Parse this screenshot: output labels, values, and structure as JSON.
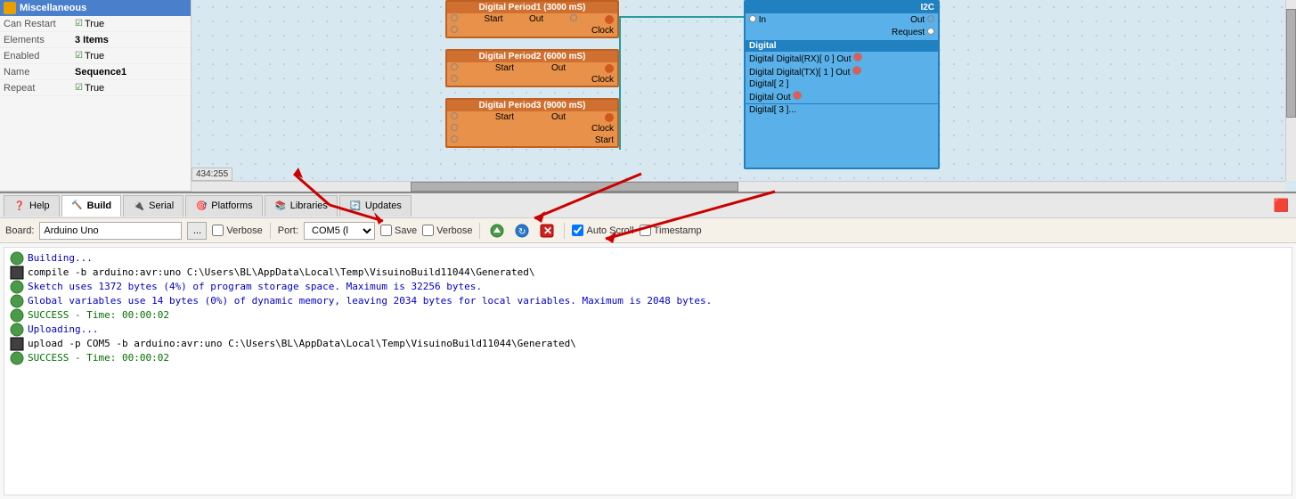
{
  "leftPanel": {
    "header": "Miscellaneous",
    "properties": [
      {
        "label": "Can Restart",
        "value": "True",
        "checkbox": true
      },
      {
        "label": "Elements",
        "value": "3 Items",
        "checkbox": false
      },
      {
        "label": "Enabled",
        "value": "True",
        "checkbox": true
      },
      {
        "label": "Name",
        "value": "Sequence1",
        "bold": true
      },
      {
        "label": "Repeat",
        "value": "True",
        "checkbox": true
      }
    ]
  },
  "canvas": {
    "coords": "434:255"
  },
  "tabs": [
    {
      "id": "help",
      "label": "Help",
      "icon": "❓",
      "active": false
    },
    {
      "id": "build",
      "label": "Build",
      "icon": "🔨",
      "active": true
    },
    {
      "id": "serial",
      "label": "Serial",
      "icon": "🔌",
      "active": false
    },
    {
      "id": "platforms",
      "label": "Platforms",
      "icon": "🎯",
      "active": false
    },
    {
      "id": "libraries",
      "label": "Libraries",
      "icon": "📚",
      "active": false
    },
    {
      "id": "updates",
      "label": "Updates",
      "icon": "🔄",
      "active": false
    }
  ],
  "toolbar": {
    "boardLabel": "Board:",
    "boardValue": "Arduino Uno",
    "browseBtn": "...",
    "verboseLabel1": "Verbose",
    "portLabel": "Port:",
    "portValue": "COM5 (l",
    "saveLabel": "Save",
    "verboseLabel2": "Verbose",
    "autoScrollLabel": "Auto Scroll",
    "timestampLabel": "Timestamp"
  },
  "output": {
    "lines": [
      {
        "type": "info",
        "text": "Building..."
      },
      {
        "type": "black",
        "text": "compile -b arduino:avr:uno C:\\Users\\BL\\AppData\\Local\\Temp\\VisuinoBuild11044\\Generated\\"
      },
      {
        "type": "info",
        "text": "Sketch uses 1372 bytes (4%) of program storage space. Maximum is 32256 bytes."
      },
      {
        "type": "info",
        "text": "Global variables use 14 bytes (0%) of dynamic memory, leaving 2034 bytes for local variables. Maximum is 2048 bytes."
      },
      {
        "type": "success",
        "text": "SUCCESS - Time: 00:00:02"
      },
      {
        "type": "info",
        "text": "Uploading..."
      },
      {
        "type": "black",
        "text": "upload -p COM5 -b arduino:avr:uno C:\\Users\\BL\\AppData\\Local\\Temp\\VisuinoBuild11044\\Generated\\"
      },
      {
        "type": "success",
        "text": "SUCCESS - Time: 00:00:02"
      }
    ]
  },
  "components": {
    "orange": [
      {
        "id": "period1",
        "header": "Digital Period1 (3000 mS)",
        "rows": [
          "Start",
          "Clock"
        ]
      },
      {
        "id": "period2",
        "header": "Digital Period2 (6000 mS)",
        "rows": [
          "Start",
          "Clock"
        ]
      },
      {
        "id": "period3",
        "header": "Digital Period3 (9000 mS)",
        "rows": [
          "Start",
          "Clock",
          "Start"
        ]
      }
    ]
  },
  "arrows": {
    "arrow1": {
      "description": "pointing to Platforms tab"
    },
    "arrow2": {
      "description": "pointing to Updates tab"
    },
    "arrow3": {
      "description": "pointing to COM5 port dropdown"
    }
  }
}
